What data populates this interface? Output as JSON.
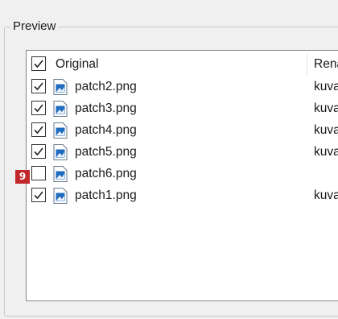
{
  "group": {
    "title": "Preview"
  },
  "columns": {
    "original": "Original",
    "renamed": "Rena"
  },
  "header_checked": true,
  "rows": [
    {
      "file": "patch2.png",
      "checked": true,
      "new_name": "kuva"
    },
    {
      "file": "patch3.png",
      "checked": true,
      "new_name": "kuva"
    },
    {
      "file": "patch4.png",
      "checked": true,
      "new_name": "kuva"
    },
    {
      "file": "patch5.png",
      "checked": true,
      "new_name": "kuva"
    },
    {
      "file": "patch6.png",
      "checked": false,
      "new_name": ""
    },
    {
      "file": "patch1.png",
      "checked": true,
      "new_name": "kuva"
    }
  ],
  "badge": {
    "label": "9",
    "color": "#c0282b"
  },
  "icons": {
    "checkbox": "checkmark-icon",
    "file": "image-file-icon"
  }
}
